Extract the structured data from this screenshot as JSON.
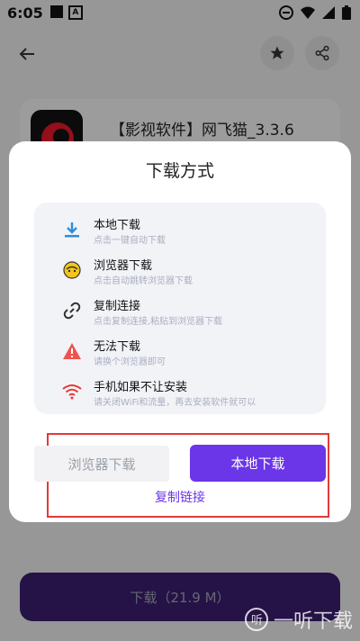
{
  "status_bar": {
    "time": "6:05"
  },
  "app_card": {
    "title": "【影视软件】网飞猫_3.3.6"
  },
  "modal": {
    "title": "下载方式",
    "options": [
      {
        "title": "本地下载",
        "subtitle": "点击一键自动下载",
        "icon": "download-icon"
      },
      {
        "title": "浏览器下载",
        "subtitle": "点击自动跳转浏览器下载",
        "icon": "browser-icon"
      },
      {
        "title": "复制连接",
        "subtitle": "点击复制连接,粘贴到浏览器下载",
        "icon": "link-icon"
      },
      {
        "title": "无法下载",
        "subtitle": "请换个浏览器即可",
        "icon": "warning-icon"
      },
      {
        "title": "手机如果不让安装",
        "subtitle": "请关闭WiFi和流量，再去安装软件就可以",
        "icon": "wifi-icon"
      }
    ],
    "buttons": {
      "browser": "浏览器下载",
      "local": "本地下载"
    },
    "copy_link": "复制链接"
  },
  "bottom": {
    "download_label": "下载（21.9 M）"
  },
  "watermark": {
    "text": "一听下载"
  },
  "colors": {
    "accent": "#6b35e8",
    "frame": "#e23a3a"
  }
}
